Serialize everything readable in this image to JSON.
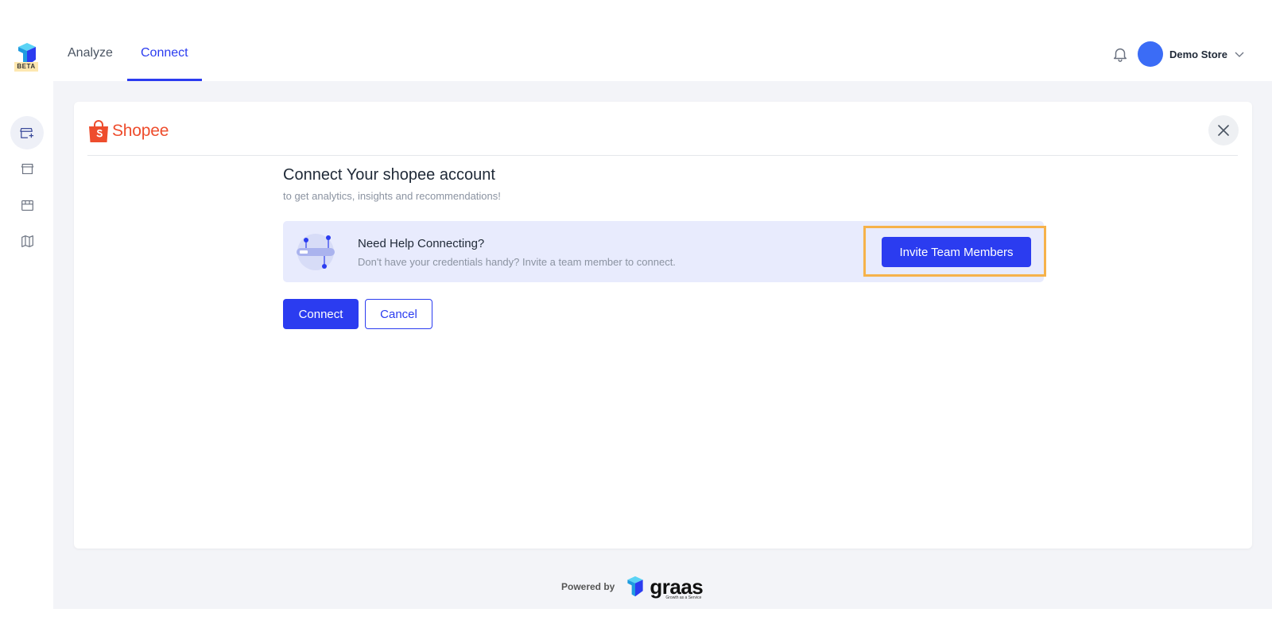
{
  "header": {
    "beta_label": "BETA",
    "nav": [
      {
        "label": "Analyze",
        "active": false
      },
      {
        "label": "Connect",
        "active": true
      }
    ],
    "store_name": "Demo Store"
  },
  "sidebar": {
    "items": [
      {
        "icon": "store-add-icon",
        "active": true
      },
      {
        "icon": "store-icon",
        "active": false
      },
      {
        "icon": "shop-front-icon",
        "active": false
      },
      {
        "icon": "map-icon",
        "active": false
      }
    ]
  },
  "card": {
    "brand": "Shopee",
    "title": "Connect Your shopee account",
    "subtitle": "to get analytics, insights and recommendations!",
    "help": {
      "title": "Need Help Connecting?",
      "description": "Don't have your credentials handy? Invite a team member to connect.",
      "invite_label": "Invite Team Members"
    },
    "connect_label": "Connect",
    "cancel_label": "Cancel"
  },
  "footer": {
    "powered_by": "Powered by",
    "brand": "graas",
    "tagline": "Growth as a Service"
  },
  "colors": {
    "accent": "#2b3cf0",
    "shopee": "#ee4d2d",
    "highlight": "#f6b24a",
    "help_bg": "#e8ebfd"
  }
}
